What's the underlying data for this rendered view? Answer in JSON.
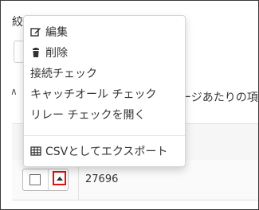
{
  "background": {
    "label_partial": "絞",
    "pagination_text": "ージあたりの項",
    "row_id": "27696",
    "arrow_glyph": "∧"
  },
  "menu": {
    "items": [
      {
        "label": "編集",
        "icon": "edit-icon"
      },
      {
        "label": "削除",
        "icon": "trash-icon"
      },
      {
        "label": "接続チェック"
      },
      {
        "label": "キャッチオール チェック"
      },
      {
        "label": "リレー チェックを開く"
      },
      {
        "label": "CSVとしてエクスポート",
        "icon": "table-icon"
      }
    ]
  },
  "colors": {
    "highlight": "#e01010",
    "border": "#d6d6d6"
  }
}
